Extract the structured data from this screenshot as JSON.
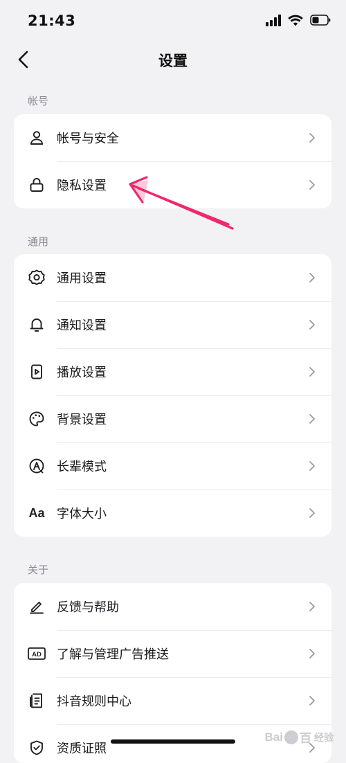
{
  "status_bar": {
    "time": "21:43"
  },
  "header": {
    "title": "设置"
  },
  "sections": [
    {
      "label": "帐号",
      "items": [
        {
          "label": "帐号与安全",
          "icon": "person-icon"
        },
        {
          "label": "隐私设置",
          "icon": "lock-icon"
        }
      ]
    },
    {
      "label": "通用",
      "items": [
        {
          "label": "通用设置",
          "icon": "gear-icon"
        },
        {
          "label": "通知设置",
          "icon": "bell-icon"
        },
        {
          "label": "播放设置",
          "icon": "play-icon"
        },
        {
          "label": "背景设置",
          "icon": "palette-icon"
        },
        {
          "label": "长辈模式",
          "icon": "elder-mode-icon"
        },
        {
          "label": "字体大小",
          "icon": "font-size-icon",
          "icon_text": "Aa"
        }
      ]
    },
    {
      "label": "关于",
      "items": [
        {
          "label": "反馈与帮助",
          "icon": "pen-icon"
        },
        {
          "label": "了解与管理广告推送",
          "icon": "ad-icon",
          "icon_text": "AD"
        },
        {
          "label": "抖音规则中心",
          "icon": "document-icon"
        },
        {
          "label": "资质证照",
          "icon": "shield-check-icon"
        }
      ]
    }
  ],
  "watermark": {
    "brand": "Bai",
    "brand_tail": "百",
    "sub": "经验"
  },
  "colors": {
    "background": "#f2f2f5",
    "card": "#ffffff",
    "annotation_arrow": "#f0286a"
  }
}
